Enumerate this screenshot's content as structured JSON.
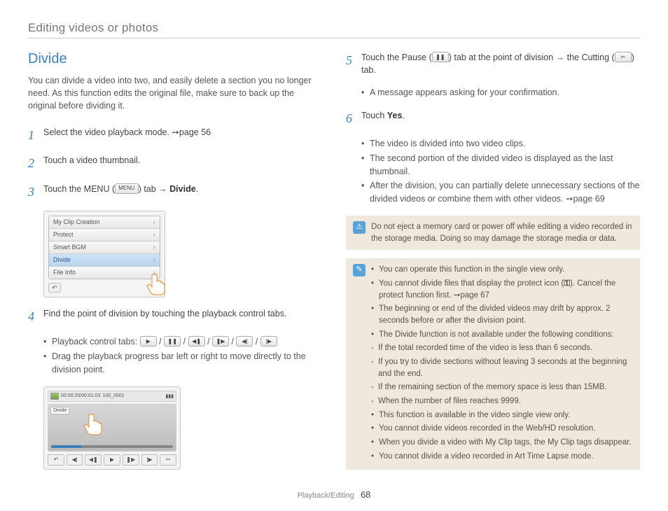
{
  "chapter": "Editing videos or photos",
  "section_title": "Divide",
  "intro": "You can divide a video into two, and easily delete a section you no longer need. As this function edits the original file, make sure to back up the original before dividing it.",
  "step1": "Select the video playback mode. ➙page 56",
  "step2": "Touch a video thumbnail.",
  "step3_a": "Touch the MENU (",
  "step3_menu": "MENU",
  "step3_b": ") tab → ",
  "step3_c": "Divide",
  "step3_d": ".",
  "menu": {
    "items": [
      "My Clip Creation",
      "Protect",
      "Smart BGM",
      "Divide",
      "File Info"
    ]
  },
  "step4": "Find the point of division by touching the playback control tabs.",
  "step4_b1a": "Playback control tabs: ",
  "step4_icons": [
    "▶",
    "❚❚",
    "◀❚",
    "❚▶",
    "◀|",
    "|▶"
  ],
  "step4_b2": "Drag the playback progress bar left or right to move directly to the division point.",
  "video": {
    "timecode": "00:00:20/00:01:03",
    "filename": "100_0001",
    "label": "Divide"
  },
  "step5_a": "Touch the Pause (",
  "step5_b": ") tab at the point of division → the Cutting (",
  "step5_c": ") tab.",
  "step5_pause": "❚❚",
  "step5_cut": "✂",
  "step5_bullet": "A message appears asking for your confirmation.",
  "step6_a": "Touch ",
  "step6_b": "Yes",
  "step6_c": ".",
  "step6_bullets": [
    "The video is divided into two video clips.",
    "The second portion of the divided video is displayed as the last thumbnail.",
    "After the division, you can partially delete unnecessary sections of the divided videos or combine them with other videos. ➙page 69"
  ],
  "warning": "Do not eject a memory card or power off while editing a video recorded in the storage media. Doing so may damage the storage media or data.",
  "info": {
    "i1": "You can operate this function in the single view only.",
    "i2a": "You cannot divide files that display the protect icon (",
    "i2key": "⚿",
    "i2b": "). Cancel the protect function first. ➙page 67",
    "i3": "The beginning or end of the divided videos may drift by approx. 2 seconds before or after the division point.",
    "i4": "The Divide function is not available under the following conditions:",
    "i4s": [
      "If the total recorded time of the video is less than 6 seconds.",
      "If you try to divide sections without leaving 3 seconds at the beginning and the end.",
      "If the remaining section of the memory space is less than 15MB.",
      "When the number of files reaches 9999."
    ],
    "i5": "This function is available in the video single view only.",
    "i6": "You cannot divide videos recorded in the Web/HD resolution.",
    "i7": "When you divide a video with My Clip tags, the My Clip tags disappear.",
    "i8": "You cannot divide a video recorded in Art Time Lapse mode."
  },
  "footer": {
    "section": "Playback/Editing",
    "page": "68"
  }
}
